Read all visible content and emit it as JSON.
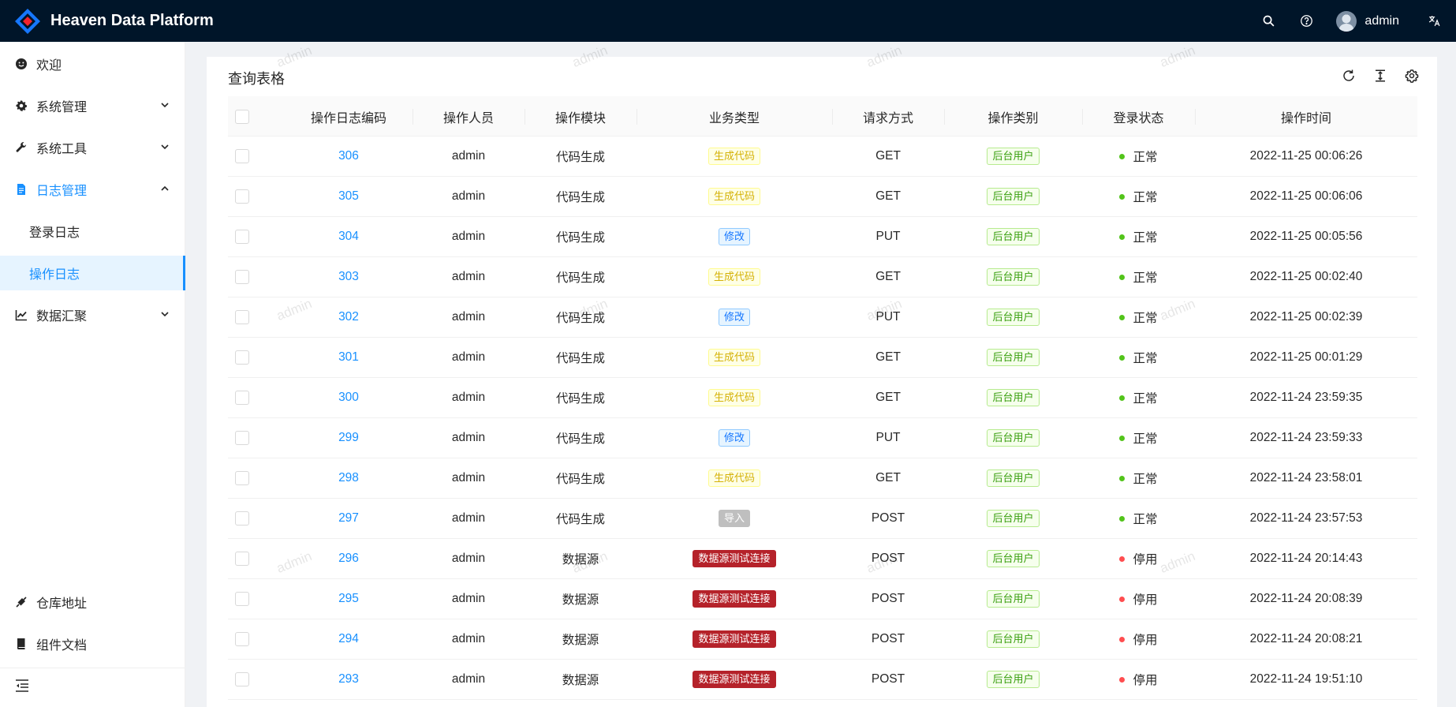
{
  "app": {
    "title": "Heaven Data Platform"
  },
  "header": {
    "user_name": "admin"
  },
  "sidebar": {
    "items": [
      {
        "label": "欢迎",
        "icon": "smile-icon"
      },
      {
        "label": "系统管理",
        "icon": "gear-icon"
      },
      {
        "label": "系统工具",
        "icon": "wrench-icon"
      },
      {
        "label": "日志管理",
        "icon": "file-icon"
      },
      {
        "label": "数据汇聚",
        "icon": "line-chart-icon"
      },
      {
        "label": "仓库地址",
        "icon": "link-icon"
      },
      {
        "label": "组件文档",
        "icon": "book-icon"
      }
    ],
    "sub_items": [
      {
        "label": "登录日志"
      },
      {
        "label": "操作日志"
      }
    ]
  },
  "main": {
    "title": "查询表格",
    "columns": [
      "操作日志编码",
      "操作人员",
      "操作模块",
      "业务类型",
      "请求方式",
      "操作类别",
      "登录状态",
      "操作时间"
    ],
    "rows": [
      {
        "id": "306",
        "operator": "admin",
        "module": "代码生成",
        "biz_type": "生成代码",
        "method": "GET",
        "category": "后台用户",
        "status": "正常",
        "time": "2022-11-25 00:06:26"
      },
      {
        "id": "305",
        "operator": "admin",
        "module": "代码生成",
        "biz_type": "生成代码",
        "method": "GET",
        "category": "后台用户",
        "status": "正常",
        "time": "2022-11-25 00:06:06"
      },
      {
        "id": "304",
        "operator": "admin",
        "module": "代码生成",
        "biz_type": "修改",
        "method": "PUT",
        "category": "后台用户",
        "status": "正常",
        "time": "2022-11-25 00:05:56"
      },
      {
        "id": "303",
        "operator": "admin",
        "module": "代码生成",
        "biz_type": "生成代码",
        "method": "GET",
        "category": "后台用户",
        "status": "正常",
        "time": "2022-11-25 00:02:40"
      },
      {
        "id": "302",
        "operator": "admin",
        "module": "代码生成",
        "biz_type": "修改",
        "method": "PUT",
        "category": "后台用户",
        "status": "正常",
        "time": "2022-11-25 00:02:39"
      },
      {
        "id": "301",
        "operator": "admin",
        "module": "代码生成",
        "biz_type": "生成代码",
        "method": "GET",
        "category": "后台用户",
        "status": "正常",
        "time": "2022-11-25 00:01:29"
      },
      {
        "id": "300",
        "operator": "admin",
        "module": "代码生成",
        "biz_type": "生成代码",
        "method": "GET",
        "category": "后台用户",
        "status": "正常",
        "time": "2022-11-24 23:59:35"
      },
      {
        "id": "299",
        "operator": "admin",
        "module": "代码生成",
        "biz_type": "修改",
        "method": "PUT",
        "category": "后台用户",
        "status": "正常",
        "time": "2022-11-24 23:59:33"
      },
      {
        "id": "298",
        "operator": "admin",
        "module": "代码生成",
        "biz_type": "生成代码",
        "method": "GET",
        "category": "后台用户",
        "status": "正常",
        "time": "2022-11-24 23:58:01"
      },
      {
        "id": "297",
        "operator": "admin",
        "module": "代码生成",
        "biz_type": "导入",
        "method": "POST",
        "category": "后台用户",
        "status": "正常",
        "time": "2022-11-24 23:57:53"
      },
      {
        "id": "296",
        "operator": "admin",
        "module": "数据源",
        "biz_type": "数据源测试连接",
        "method": "POST",
        "category": "后台用户",
        "status": "停用",
        "time": "2022-11-24 20:14:43"
      },
      {
        "id": "295",
        "operator": "admin",
        "module": "数据源",
        "biz_type": "数据源测试连接",
        "method": "POST",
        "category": "后台用户",
        "status": "停用",
        "time": "2022-11-24 20:08:39"
      },
      {
        "id": "294",
        "operator": "admin",
        "module": "数据源",
        "biz_type": "数据源测试连接",
        "method": "POST",
        "category": "后台用户",
        "status": "停用",
        "time": "2022-11-24 20:08:21"
      },
      {
        "id": "293",
        "operator": "admin",
        "module": "数据源",
        "biz_type": "数据源测试连接",
        "method": "POST",
        "category": "后台用户",
        "status": "停用",
        "time": "2022-11-24 19:51:10"
      }
    ]
  },
  "watermark": "admin",
  "colors": {
    "header_bg": "#001529",
    "primary": "#1890ff",
    "status_ok": "#52c41a",
    "status_off": "#ff4d4f"
  }
}
